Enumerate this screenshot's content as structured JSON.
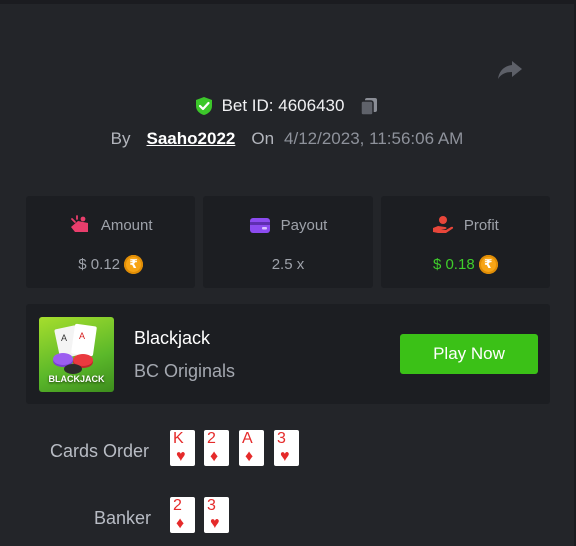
{
  "bet": {
    "id_label": "Bet ID: 4606430",
    "by_label": "By",
    "username": "Saaho2022",
    "on_label": "On",
    "datetime": "4/12/2023, 11:56:06 AM"
  },
  "stats": {
    "amount": {
      "label": "Amount",
      "value": "$ 0.12",
      "currency_icon": "rupee-coin-icon"
    },
    "payout": {
      "label": "Payout",
      "value": "2.5 x"
    },
    "profit": {
      "label": "Profit",
      "value": "$ 0.18",
      "currency_icon": "rupee-coin-icon",
      "color": "#3fcd2b"
    }
  },
  "coin_symbol": "₹",
  "game": {
    "name": "Blackjack",
    "provider": "BC Originals",
    "thumb_text": "BLACKJACK",
    "play_label": "Play Now"
  },
  "cards_order": {
    "label": "Cards Order",
    "cards": [
      {
        "rank": "K",
        "suit": "♥"
      },
      {
        "rank": "2",
        "suit": "♦"
      },
      {
        "rank": "A",
        "suit": "♦"
      },
      {
        "rank": "3",
        "suit": "♥"
      }
    ]
  },
  "banker": {
    "label": "Banker",
    "cards": [
      {
        "rank": "2",
        "suit": "♦"
      },
      {
        "rank": "3",
        "suit": "♥"
      }
    ]
  },
  "colors": {
    "accent_green": "#3bc117",
    "card_red": "#e52a2a",
    "coin": "#f7a415"
  }
}
